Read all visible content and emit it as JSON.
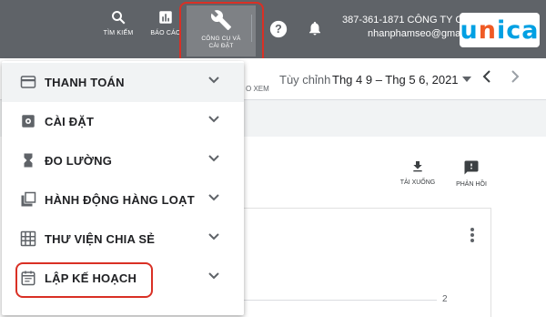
{
  "topbar": {
    "search_label": "TÌM KIẾM",
    "reports_label": "BÁO CÁO",
    "tools_label_line1": "CÔNG CỤ VÀ",
    "tools_label_line2": "CÀI ĐẶT",
    "account_line1": "387-361-1871 CÔNG TY CP",
    "account_line2": "nhanphamseo@gmail"
  },
  "logo": {
    "letters": [
      "u",
      "n",
      "i",
      "c",
      "a"
    ]
  },
  "subbar": {
    "xem_text": "O XEM",
    "custom_label": "Tùy chỉnh",
    "date_range": "Thg 4 9 – Thg 5 6, 2021"
  },
  "actions": {
    "download_label": "TẢI XUỐNG",
    "feedback_label": "PHẢN HỒI"
  },
  "chart": {
    "tick_label": "2"
  },
  "menu": {
    "items": [
      {
        "label": "THANH TOÁN",
        "icon": "credit-card-icon"
      },
      {
        "label": "CÀI ĐẶT",
        "icon": "settings-icon"
      },
      {
        "label": "ĐO LƯỜNG",
        "icon": "hourglass-icon"
      },
      {
        "label": "HÀNH ĐỘNG HÀNG LOẠT",
        "icon": "bulk-actions-icon"
      },
      {
        "label": "THƯ VIỆN CHIA SẺ",
        "icon": "shared-library-icon"
      },
      {
        "label": "LẬP KẾ HOẠCH",
        "icon": "planning-icon"
      }
    ]
  },
  "colors": {
    "topbar": "#5f6368",
    "highlight": "#d93025",
    "logo_blue": "#00a0e3",
    "logo_orange": "#ef5a24"
  }
}
